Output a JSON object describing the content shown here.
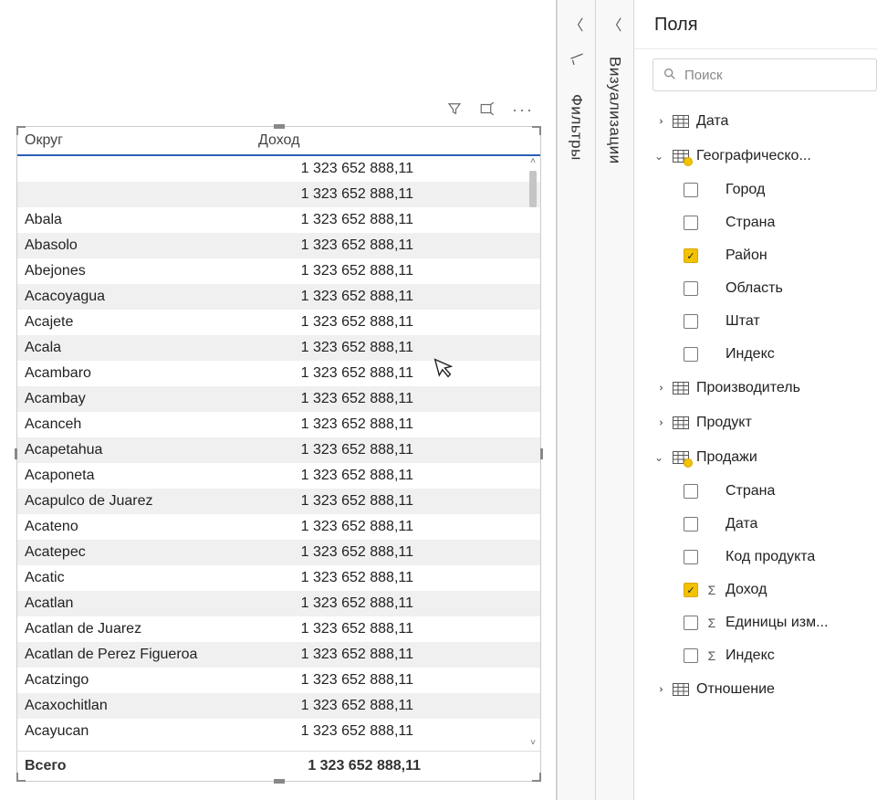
{
  "visual_toolbar": {
    "filter_icon": "filter-icon",
    "focus_icon": "focus-mode-icon",
    "more_icon": "more-options-icon"
  },
  "table": {
    "headers": {
      "okrug": "Округ",
      "dohod": "Доход"
    },
    "common_value": "1 323 652 888,11",
    "rows": [
      {
        "okrug": "",
        "dohod": "1 323 652 888,11"
      },
      {
        "okrug": "",
        "dohod": "1 323 652 888,11"
      },
      {
        "okrug": "Abala",
        "dohod": "1 323 652 888,11"
      },
      {
        "okrug": "Abasolo",
        "dohod": "1 323 652 888,11"
      },
      {
        "okrug": "Abejones",
        "dohod": "1 323 652 888,11"
      },
      {
        "okrug": "Acacoyagua",
        "dohod": "1 323 652 888,11"
      },
      {
        "okrug": "Acajete",
        "dohod": "1 323 652 888,11"
      },
      {
        "okrug": "Acala",
        "dohod": "1 323 652 888,11"
      },
      {
        "okrug": "Acambaro",
        "dohod": "1 323 652 888,11"
      },
      {
        "okrug": "Acambay",
        "dohod": "1 323 652 888,11"
      },
      {
        "okrug": "Acanceh",
        "dohod": "1 323 652 888,11"
      },
      {
        "okrug": "Acapetahua",
        "dohod": "1 323 652 888,11"
      },
      {
        "okrug": "Acaponeta",
        "dohod": "1 323 652 888,11"
      },
      {
        "okrug": "Acapulco de Juarez",
        "dohod": "1 323 652 888,11"
      },
      {
        "okrug": "Acateno",
        "dohod": "1 323 652 888,11"
      },
      {
        "okrug": "Acatepec",
        "dohod": "1 323 652 888,11"
      },
      {
        "okrug": "Acatic",
        "dohod": "1 323 652 888,11"
      },
      {
        "okrug": "Acatlan",
        "dohod": "1 323 652 888,11"
      },
      {
        "okrug": "Acatlan de Juarez",
        "dohod": "1 323 652 888,11"
      },
      {
        "okrug": "Acatlan de Perez Figueroa",
        "dohod": "1 323 652 888,11"
      },
      {
        "okrug": "Acatzingo",
        "dohod": "1 323 652 888,11"
      },
      {
        "okrug": "Acaxochitlan",
        "dohod": "1 323 652 888,11"
      },
      {
        "okrug": "Acayucan",
        "dohod": "1 323 652 888,11"
      }
    ],
    "total_label": "Всего",
    "total_value": "1 323 652 888,11"
  },
  "panes": {
    "filters_label": "Фильтры",
    "visuals_label": "Визуализации",
    "fields_label": "Поля",
    "search_placeholder": "Поиск"
  },
  "fields": {
    "tables": [
      {
        "name": "Дата",
        "expanded": false,
        "badge": false,
        "fields": []
      },
      {
        "name": "Географическо...",
        "expanded": true,
        "badge": true,
        "fields": [
          {
            "label": "Город",
            "checked": false,
            "sigma": false
          },
          {
            "label": "Страна",
            "checked": false,
            "sigma": false
          },
          {
            "label": "Район",
            "checked": true,
            "sigma": false
          },
          {
            "label": "Область",
            "checked": false,
            "sigma": false
          },
          {
            "label": "Штат",
            "checked": false,
            "sigma": false
          },
          {
            "label": "Индекс",
            "checked": false,
            "sigma": false
          }
        ]
      },
      {
        "name": "Производитель",
        "expanded": false,
        "badge": false,
        "fields": []
      },
      {
        "name": "Продукт",
        "expanded": false,
        "badge": false,
        "fields": []
      },
      {
        "name": "Продажи",
        "expanded": true,
        "badge": true,
        "fields": [
          {
            "label": "Страна",
            "checked": false,
            "sigma": false
          },
          {
            "label": "Дата",
            "checked": false,
            "sigma": false
          },
          {
            "label": "Код продукта",
            "checked": false,
            "sigma": false
          },
          {
            "label": "Доход",
            "checked": true,
            "sigma": true
          },
          {
            "label": "Единицы изм...",
            "checked": false,
            "sigma": true
          },
          {
            "label": "Индекс",
            "checked": false,
            "sigma": true
          }
        ]
      },
      {
        "name": "Отношение",
        "expanded": false,
        "badge": false,
        "fields": []
      }
    ]
  }
}
